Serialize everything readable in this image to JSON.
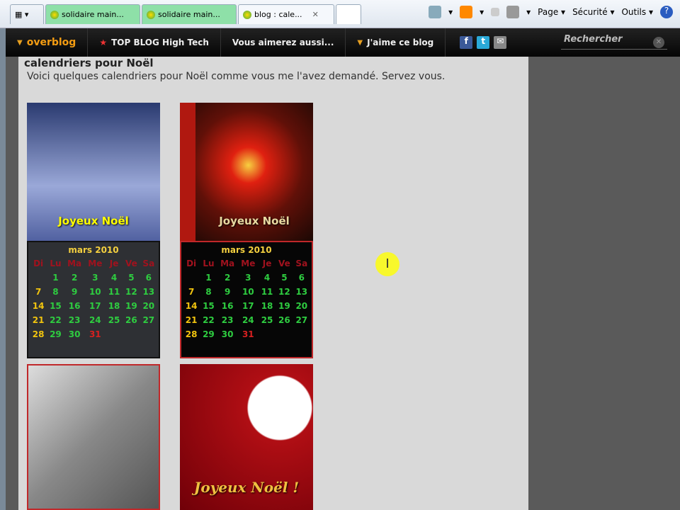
{
  "browser": {
    "tabs": [
      {
        "label": "solidaire main..."
      },
      {
        "label": "solidaire main..."
      },
      {
        "label": "blog : cale..."
      }
    ],
    "tools": [
      "Page",
      "Sécurité",
      "Outils"
    ]
  },
  "nav": {
    "logo": "overblog",
    "items": [
      "TOP BLOG High Tech",
      "Vous aimerez aussi...",
      "J'aime ce blog"
    ],
    "search_placeholder": "Rechercher"
  },
  "post": {
    "title": "calendriers pour Noël",
    "intro": "Voici quelques calendriers pour Noël comme vous me l'avez demandé. Servez vous."
  },
  "images": [
    {
      "caption": "Joyeux Noël"
    },
    {
      "caption": "Joyeux Noël"
    },
    {
      "caption": ""
    },
    {
      "caption": "Joyeux Noël !"
    }
  ],
  "calendar": {
    "month": "mars 2010",
    "weekdays": [
      "Di",
      "Lu",
      "Ma",
      "Me",
      "Je",
      "Ve",
      "Sa"
    ],
    "weeks": [
      [
        "",
        "1",
        "2",
        "3",
        "4",
        "5",
        "6"
      ],
      [
        "7",
        "8",
        "9",
        "10",
        "11",
        "12",
        "13"
      ],
      [
        "14",
        "15",
        "16",
        "17",
        "18",
        "19",
        "20"
      ],
      [
        "21",
        "22",
        "23",
        "24",
        "25",
        "26",
        "27"
      ],
      [
        "28",
        "29",
        "30",
        "31",
        "",
        "",
        ""
      ]
    ],
    "highlight_day": "31"
  }
}
